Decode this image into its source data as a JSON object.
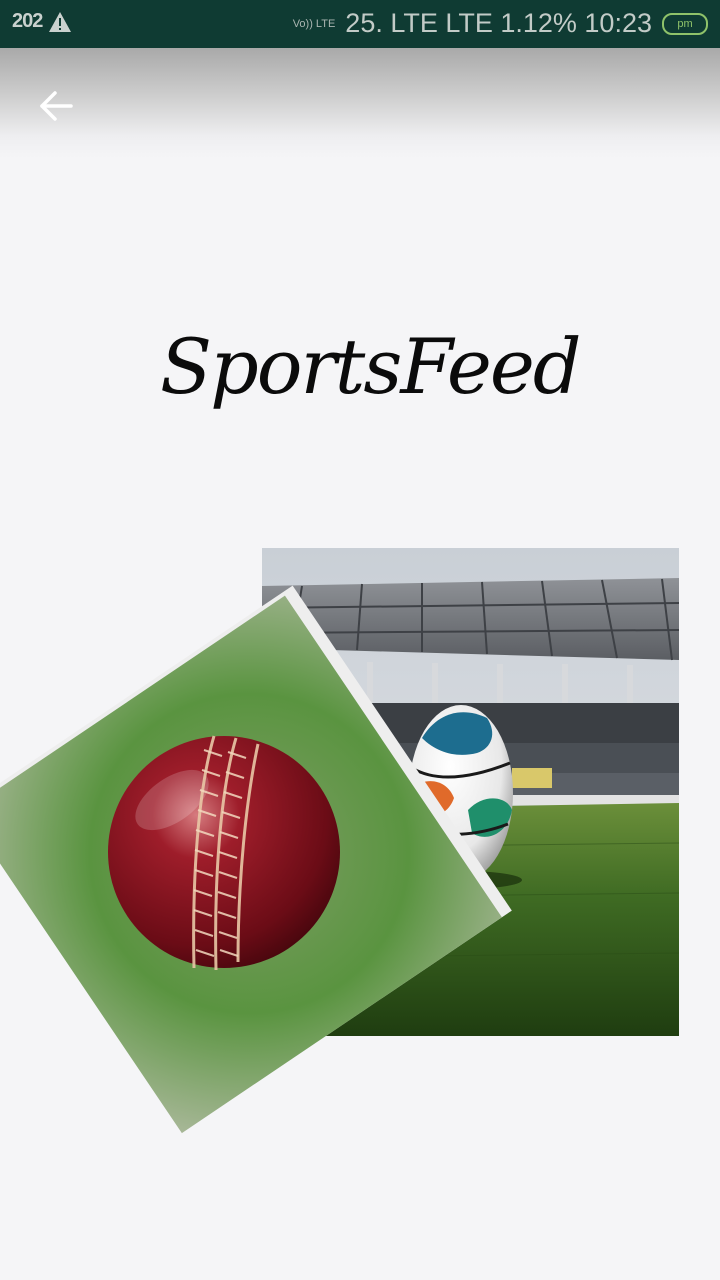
{
  "status_bar": {
    "left_number": "202",
    "volte_label": "Vo)) LTE",
    "right_text": "25. LTE LTE 1.12% 10:23",
    "battery_label": "pm"
  },
  "app_bar": {
    "back_icon": "arrow-left-icon"
  },
  "logo": {
    "text": "SportsFeed"
  },
  "images": {
    "stadium": "football-stadium-photo",
    "cricket": "cricket-ball-photo"
  },
  "colors": {
    "status_bar": "#0f3b33",
    "background": "#f5f5f7",
    "grass": "#3f6b23",
    "cricket_ball": "#7a0f1c"
  }
}
